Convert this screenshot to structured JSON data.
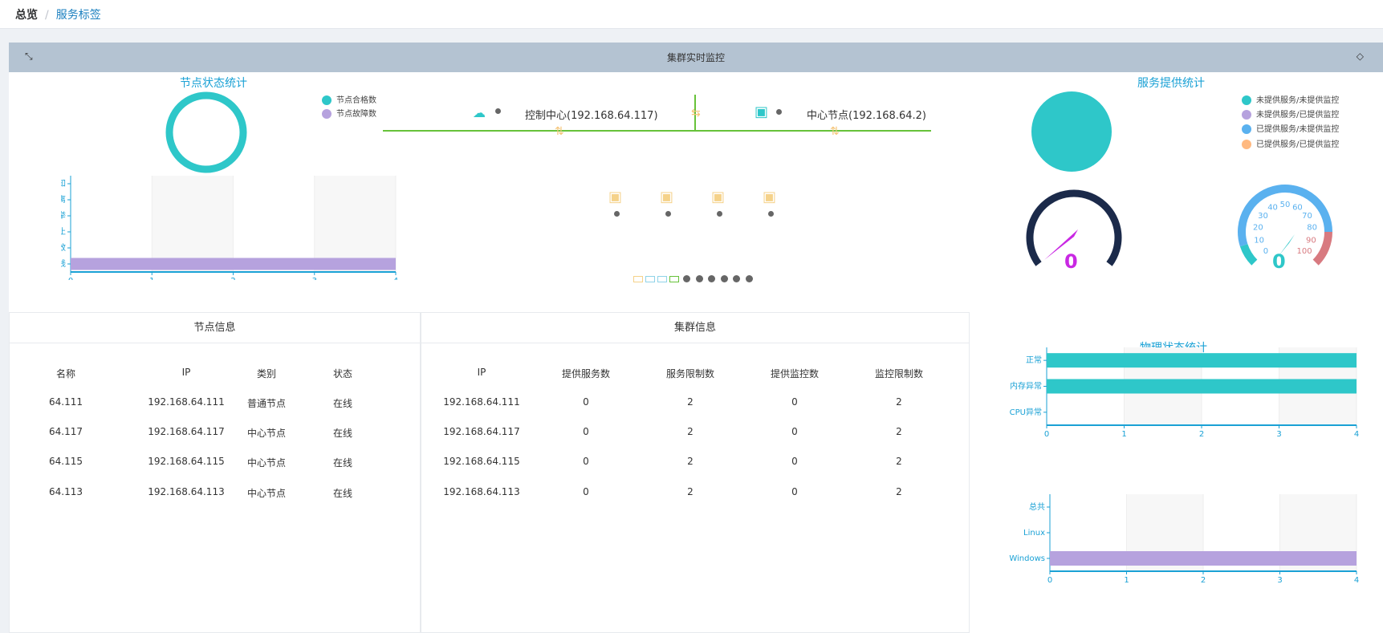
{
  "breadcrumb": {
    "home": "总览",
    "separator": "/",
    "current": "服务标签"
  },
  "panel": {
    "title": "集群实时监控",
    "expand_icon": "expand-icon",
    "settings_icon": "settings-icon"
  },
  "node_status": {
    "title": "节点状态统计",
    "legend": [
      {
        "name": "节点合格数",
        "color": "#2ec7c9"
      },
      {
        "name": "节点故障数",
        "color": "#b6a2de"
      }
    ],
    "bar": {
      "categories": [
        "未知",
        "游离",
        "选举",
        "停止",
        "失效",
        "在线"
      ],
      "values": [
        0,
        0,
        0,
        0,
        0,
        4
      ],
      "ticks": [
        "0",
        "1",
        "2",
        "3",
        "4"
      ],
      "color": "#b6a2de"
    }
  },
  "topology": {
    "control_center": "控制中心(192.168.64.117)",
    "center_node": "中心节点(192.168.64.2)",
    "node_count": 4,
    "line_color": "#67c23a",
    "pager_dots": 6
  },
  "service_stats": {
    "title": "服务提供统计",
    "legend": [
      {
        "name": "未提供服务/未提供监控",
        "color": "#2ec7c9"
      },
      {
        "name": "未提供服务/已提供监控",
        "color": "#b6a2de"
      },
      {
        "name": "已提供服务/未提供监控",
        "color": "#5ab1ef"
      },
      {
        "name": "已提供服务/已提供监控",
        "color": "#ffb980"
      }
    ],
    "gauge_left_value": "0",
    "gauge_right_value": "0",
    "gauge_right_ticks": [
      "0",
      "10",
      "20",
      "30",
      "40",
      "50",
      "60",
      "70",
      "80",
      "90",
      "100"
    ]
  },
  "node_info": {
    "title": "节点信息",
    "headers": [
      "名称",
      "IP",
      "类别",
      "状态"
    ],
    "rows": [
      [
        "64.111",
        "192.168.64.111",
        "普通节点",
        "在线"
      ],
      [
        "64.117",
        "192.168.64.117",
        "中心节点",
        "在线"
      ],
      [
        "64.115",
        "192.168.64.115",
        "中心节点",
        "在线"
      ],
      [
        "64.113",
        "192.168.64.113",
        "中心节点",
        "在线"
      ]
    ]
  },
  "cluster_info": {
    "title": "集群信息",
    "headers": [
      "IP",
      "提供服务数",
      "服务限制数",
      "提供监控数",
      "监控限制数"
    ],
    "rows": [
      [
        "192.168.64.111",
        "0",
        "2",
        "0",
        "2"
      ],
      [
        "192.168.64.117",
        "0",
        "2",
        "0",
        "2"
      ],
      [
        "192.168.64.115",
        "0",
        "2",
        "0",
        "2"
      ],
      [
        "192.168.64.113",
        "0",
        "2",
        "0",
        "2"
      ]
    ]
  },
  "physical": {
    "title": "物理状态统计",
    "chart1": {
      "categories": [
        "正常",
        "内存异常",
        "CPU异常"
      ],
      "values": [
        4,
        4,
        0
      ],
      "ticks": [
        "0",
        "1",
        "2",
        "3",
        "4"
      ],
      "color": "#2ec7c9"
    },
    "chart2": {
      "categories": [
        "总共",
        "Linux",
        "Windows"
      ],
      "values": [
        0,
        0,
        4
      ],
      "ticks": [
        "0",
        "1",
        "2",
        "3",
        "4"
      ],
      "color": "#b6a2de"
    }
  },
  "chart_data": [
    {
      "type": "pie",
      "title": "节点状态统计",
      "series": [
        {
          "name": "节点合格数",
          "values": [
            4
          ]
        },
        {
          "name": "节点故障数",
          "values": [
            0
          ]
        }
      ]
    },
    {
      "type": "bar",
      "categories": [
        "未知",
        "游离",
        "选举",
        "停止",
        "失效",
        "在线"
      ],
      "values": [
        0,
        0,
        0,
        0,
        0,
        4
      ],
      "xlim": [
        0,
        4
      ]
    },
    {
      "type": "pie",
      "title": "服务提供统计",
      "series": [
        {
          "name": "未提供服务/未提供监控",
          "values": [
            4
          ]
        },
        {
          "name": "未提供服务/已提供监控",
          "values": [
            0
          ]
        },
        {
          "name": "已提供服务/未提供监控",
          "values": [
            0
          ]
        },
        {
          "name": "已提供服务/已提供监控",
          "values": [
            0
          ]
        }
      ]
    },
    {
      "type": "bar",
      "title": "物理状态统计",
      "categories": [
        "正常",
        "内存异常",
        "CPU异常"
      ],
      "values": [
        4,
        4,
        0
      ],
      "xlim": [
        0,
        4
      ]
    },
    {
      "type": "bar",
      "categories": [
        "总共",
        "Linux",
        "Windows"
      ],
      "values": [
        0,
        0,
        4
      ],
      "xlim": [
        0,
        4
      ]
    }
  ]
}
